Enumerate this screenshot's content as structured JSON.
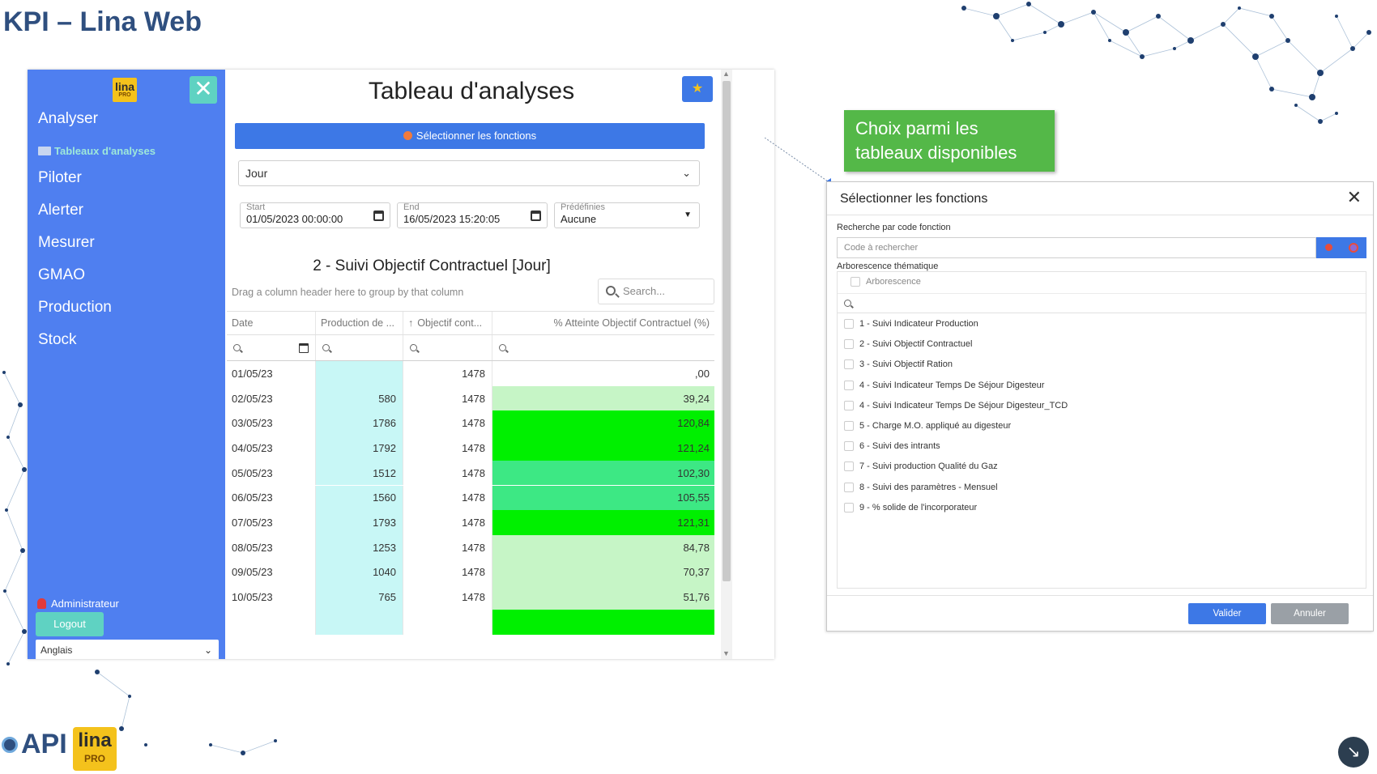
{
  "slide": {
    "title": "KPI – Lina Web"
  },
  "sidebar": {
    "logo_text": "lina",
    "logo_sub": "PRO",
    "close_label": "✕",
    "items": [
      {
        "label": "Analyser"
      },
      {
        "label": "Piloter"
      },
      {
        "label": "Alerter"
      },
      {
        "label": "Mesurer"
      },
      {
        "label": "GMAO"
      },
      {
        "label": "Production"
      },
      {
        "label": "Stock"
      }
    ],
    "sub_item": "Tableaux d'analyses",
    "user": "Administrateur",
    "logout_label": "Logout",
    "language": "Anglais"
  },
  "main": {
    "title": "Tableau d'analyses",
    "star_icon": "star-icon",
    "select_functions_label": "Sélectionner les fonctions",
    "period": "Jour",
    "start_label": "Start",
    "start_value": "01/05/2023 00:00:00",
    "end_label": "End",
    "end_value": "16/05/2023 15:20:05",
    "predef_label": "Prédéfinies",
    "predef_value": "Aucune",
    "grid_title": "2 - Suivi Objectif Contractuel [Jour]",
    "group_hint": "Drag a column header here to group by that column",
    "search_placeholder": "Search...",
    "columns": [
      "Date",
      "Production de ...",
      "Objectif cont...",
      "% Atteinte Objectif Contractuel (%)"
    ],
    "sort_icon": "↑",
    "rows": [
      {
        "date": "01/05/23",
        "production": "",
        "objectif": "1478",
        "atteinte": ",00",
        "level": "none"
      },
      {
        "date": "02/05/23",
        "production": "580",
        "objectif": "1478",
        "atteinte": "39,24",
        "level": "low"
      },
      {
        "date": "03/05/23",
        "production": "1786",
        "objectif": "1478",
        "atteinte": "120,84",
        "level": "high"
      },
      {
        "date": "04/05/23",
        "production": "1792",
        "objectif": "1478",
        "atteinte": "121,24",
        "level": "high"
      },
      {
        "date": "05/05/23",
        "production": "1512",
        "objectif": "1478",
        "atteinte": "102,30",
        "level": "mid"
      },
      {
        "date": "06/05/23",
        "production": "1560",
        "objectif": "1478",
        "atteinte": "105,55",
        "level": "mid"
      },
      {
        "date": "07/05/23",
        "production": "1793",
        "objectif": "1478",
        "atteinte": "121,31",
        "level": "high"
      },
      {
        "date": "08/05/23",
        "production": "1253",
        "objectif": "1478",
        "atteinte": "84,78",
        "level": "low"
      },
      {
        "date": "09/05/23",
        "production": "1040",
        "objectif": "1478",
        "atteinte": "70,37",
        "level": "low"
      },
      {
        "date": "10/05/23",
        "production": "765",
        "objectif": "1478",
        "atteinte": "51,76",
        "level": "low"
      },
      {
        "date": "",
        "production": "",
        "objectif": "",
        "atteinte": "",
        "level": "high"
      }
    ],
    "level_colors": {
      "none": "#ffffff",
      "low": "#c6f5c6",
      "mid": "#3de884",
      "high": "#00f000"
    }
  },
  "callout": {
    "text": "Choix parmi les tableaux disponibles",
    "color": "#54b848"
  },
  "dialog": {
    "title": "Sélectionner les fonctions",
    "close_label": "✕",
    "search_label": "Recherche par code fonction",
    "search_placeholder": "Code à rechercher",
    "tree_label": "Arborescence thématique",
    "tree_head": "Arborescence",
    "items": [
      "1 - Suivi Indicateur Production",
      "2 - Suivi Objectif Contractuel",
      "3 - Suivi Objectif Ration",
      "4 - Suivi Indicateur Temps De Séjour Digesteur",
      "4 - Suivi Indicateur Temps De Séjour Digesteur_TCD",
      "5 - Charge M.O. appliqué au digesteur",
      "6 - Suivi des intrants",
      "7 - Suivi production Qualité du Gaz",
      "8 - Suivi des paramètres - Mensuel",
      "9 - % solide de l'incorporateur"
    ],
    "valider_label": "Valider",
    "annuler_label": "Annuler"
  },
  "footer": {
    "api_logo_text": "API",
    "lina_logo_text": "lina",
    "lina_logo_sub": "PRO",
    "corner_icon": "arrow-down-right-icon"
  }
}
